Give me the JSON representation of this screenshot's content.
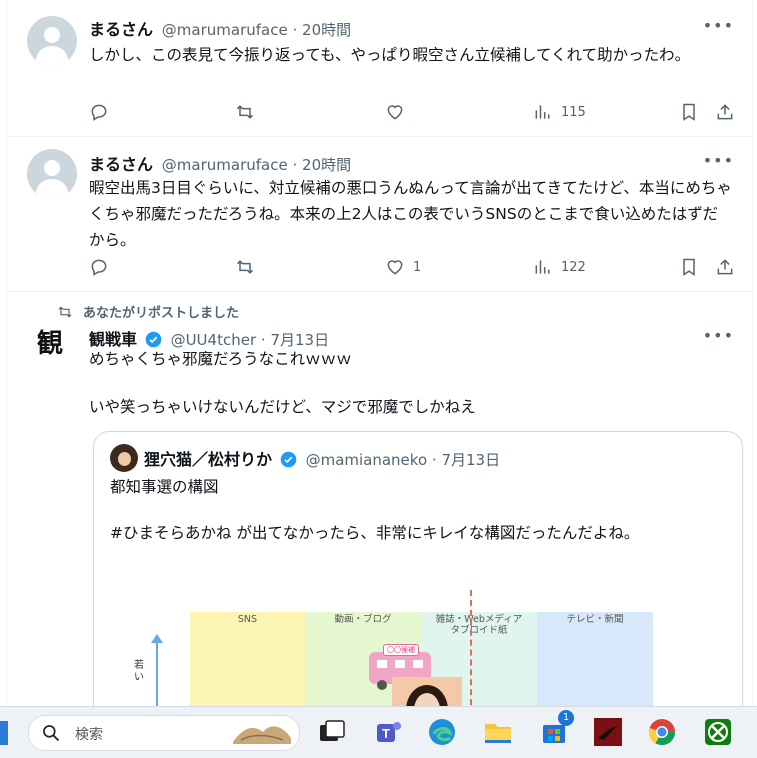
{
  "tweets": [
    {
      "name": "まるさん",
      "handle": "@marumaruface",
      "time": "20時間",
      "text": "しかし、この表見て今振り返っても、やっぱり暇空さん立候補してくれて助かったわ。",
      "replies": "",
      "reposts": "",
      "likes": "",
      "views": "115"
    },
    {
      "name": "まるさん",
      "handle": "@marumaruface",
      "time": "20時間",
      "text": "暇空出馬3日目ぐらいに、対立候補の悪口うんぬんって言論が出てきてたけど、本当にめちゃくちゃ邪魔だっただろうね。本来の上2人はこの表でいうSNSのとこまで食い込めたはずだから。",
      "replies": "",
      "reposts": "",
      "likes": "1",
      "views": "122"
    }
  ],
  "repost": {
    "label": "あなたがリポストしました",
    "name": "観戦車",
    "handle": "@UU4tcher",
    "time": "7月13日",
    "avatar_text": "観",
    "text_line1": "めちゃくちゃ邪魔だろうなこれｗｗｗ",
    "text_line2": "いや笑っちゃいけないんだけど、マジで邪魔でしかねえ"
  },
  "quote": {
    "name": "狸穴猫／松村りか",
    "handle": "@mamiananeko",
    "time": "7月13日",
    "text_line1": "都知事選の構図",
    "text_line2": "#ひまそらあかね が出てなかったら、非常にキレイな構図だったんだよね。",
    "chart": {
      "bands": [
        "SNS",
        "動画・ブログ",
        "雑誌・Webメディア\nタブロイド紙",
        "テレビ・新聞"
      ],
      "band_colors": [
        "#fdf6b3",
        "#e5f7cf",
        "#dff5ee",
        "#d6e8fa"
      ],
      "y_label": "若\nい",
      "car_sign": "〇〇候補"
    }
  },
  "taskbar": {
    "search_placeholder": "検索",
    "store_badge": "1"
  },
  "colors": {
    "secondary_text": "#536471",
    "verified_blue": "#1d9bf0",
    "divider": "#eff3f4"
  }
}
